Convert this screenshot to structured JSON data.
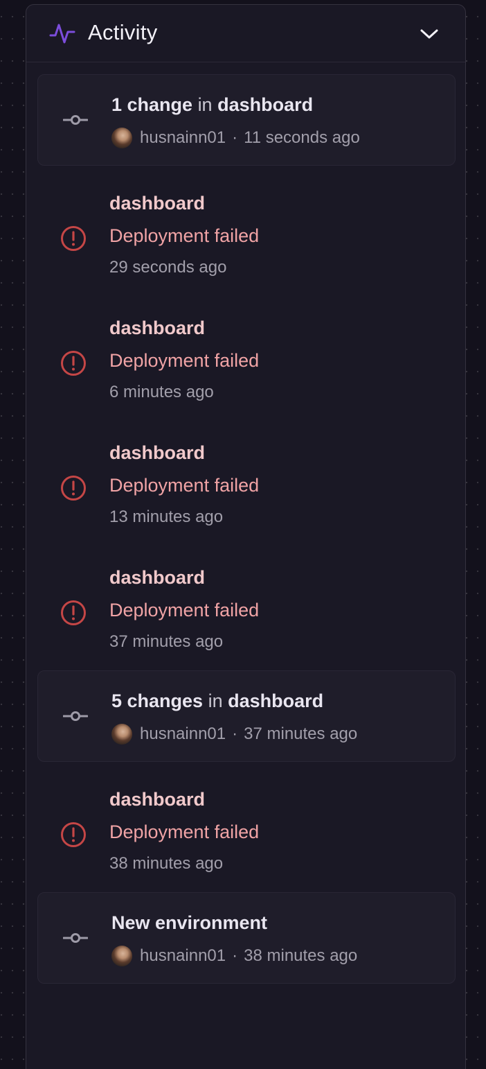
{
  "panel": {
    "title": "Activity",
    "icon": "activity-pulse-icon",
    "accent": "#7c4ddc"
  },
  "feed": {
    "items": [
      {
        "kind": "changes",
        "count_label": "1 change",
        "connector": "in",
        "service": "dashboard",
        "user": "husnainn01",
        "separator": "·",
        "time": "11 seconds ago"
      },
      {
        "kind": "deploy-failed",
        "service": "dashboard",
        "status": "Deployment failed",
        "time": "29 seconds ago"
      },
      {
        "kind": "deploy-failed",
        "service": "dashboard",
        "status": "Deployment failed",
        "time": "6 minutes ago"
      },
      {
        "kind": "deploy-failed",
        "service": "dashboard",
        "status": "Deployment failed",
        "time": "13 minutes ago"
      },
      {
        "kind": "deploy-failed",
        "service": "dashboard",
        "status": "Deployment failed",
        "time": "37 minutes ago"
      },
      {
        "kind": "changes",
        "count_label": "5 changes",
        "connector": "in",
        "service": "dashboard",
        "user": "husnainn01",
        "separator": "·",
        "time": "37 minutes ago"
      },
      {
        "kind": "deploy-failed",
        "service": "dashboard",
        "status": "Deployment failed",
        "time": "38 minutes ago"
      },
      {
        "kind": "environment",
        "title": "New environment",
        "user": "husnainn01",
        "separator": "·",
        "time": "38 minutes ago"
      }
    ]
  },
  "colors": {
    "error": "#c54646",
    "error_text": "#f0a3a5",
    "commit_icon": "#9e9ba8"
  }
}
